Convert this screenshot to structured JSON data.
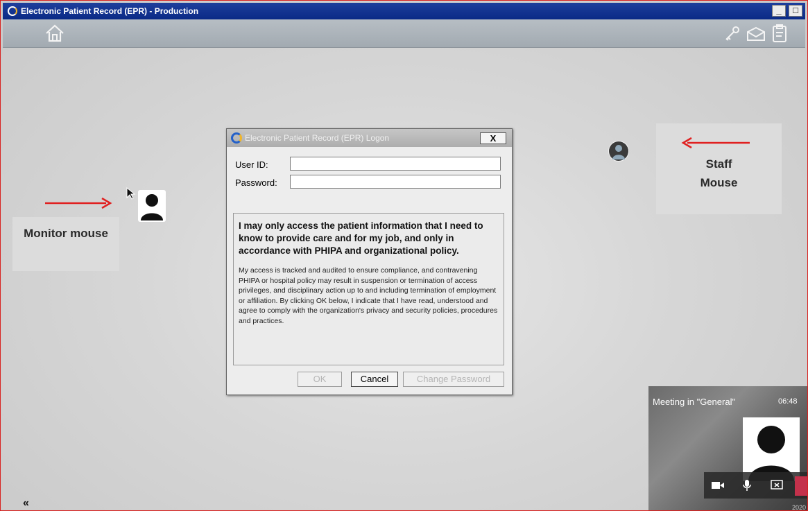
{
  "window": {
    "title": "Electronic Patient Record (EPR) - Production",
    "minimize_label": "_",
    "maximize_label": "□"
  },
  "toolbar": {
    "icons": [
      "home-icon",
      "key-icon",
      "envelope-icon",
      "clipboard-icon"
    ]
  },
  "annotations": {
    "monitor_label": "Monitor mouse",
    "staff_label": "Staff Mouse",
    "arrow_color": "#e02020"
  },
  "login_dialog": {
    "title": "Electronic Patient Record (EPR) Logon",
    "close_label": "X",
    "user_id_label": "User ID:",
    "user_id_value": "",
    "password_label": "Password:",
    "password_value": "",
    "notice_heading": "I may only access the patient information that I need to know to provide care and for my job, and only in accordance with PHIPA and organizational policy.",
    "notice_body": "My access is tracked and audited to ensure compliance, and contravening PHIPA or hospital policy may result in suspension or termination of access privileges, and disciplinary action up to and including termination of employment or affiliation.  By clicking OK below, I indicate that I have read, understood and agree to comply with the organization's privacy and security policies, procedures and practices.",
    "ok_label": "OK",
    "cancel_label": "Cancel",
    "change_password_label": "Change Password"
  },
  "meeting": {
    "label": "Meeting in \"General\"",
    "time": "06:48",
    "date": "2020"
  },
  "collapse_label": "«",
  "colors": {
    "titlebar": "#0a2a86",
    "frame_border": "#d8201e",
    "hangup": "#c4314b"
  }
}
